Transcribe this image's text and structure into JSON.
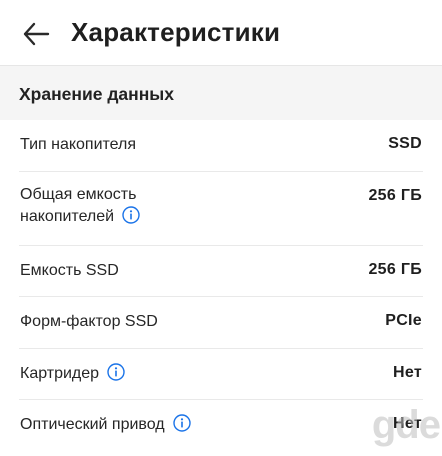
{
  "header": {
    "title": "Характеристики",
    "back_icon": "arrow-left-icon"
  },
  "section": {
    "title": "Хранение данных"
  },
  "rows": [
    {
      "label": "Тип накопителя",
      "value": "SSD",
      "info": false
    },
    {
      "label_line1": "Общая емкость",
      "label_line2": "накопителей",
      "value": "256 ГБ",
      "info": true
    },
    {
      "label": "Емкость SSD",
      "value": "256 ГБ",
      "info": false
    },
    {
      "label": "Форм-фактор SSD",
      "value": "PCIe",
      "info": false
    },
    {
      "label": "Картридер",
      "value": "Нет",
      "info": true
    },
    {
      "label": "Оптический привод",
      "value": "Нет",
      "info": true
    }
  ],
  "watermark": {
    "text": "gde"
  },
  "colors": {
    "accent": "#1a73e8",
    "text": "#1f1f1f",
    "background": "#f5f5f5"
  }
}
